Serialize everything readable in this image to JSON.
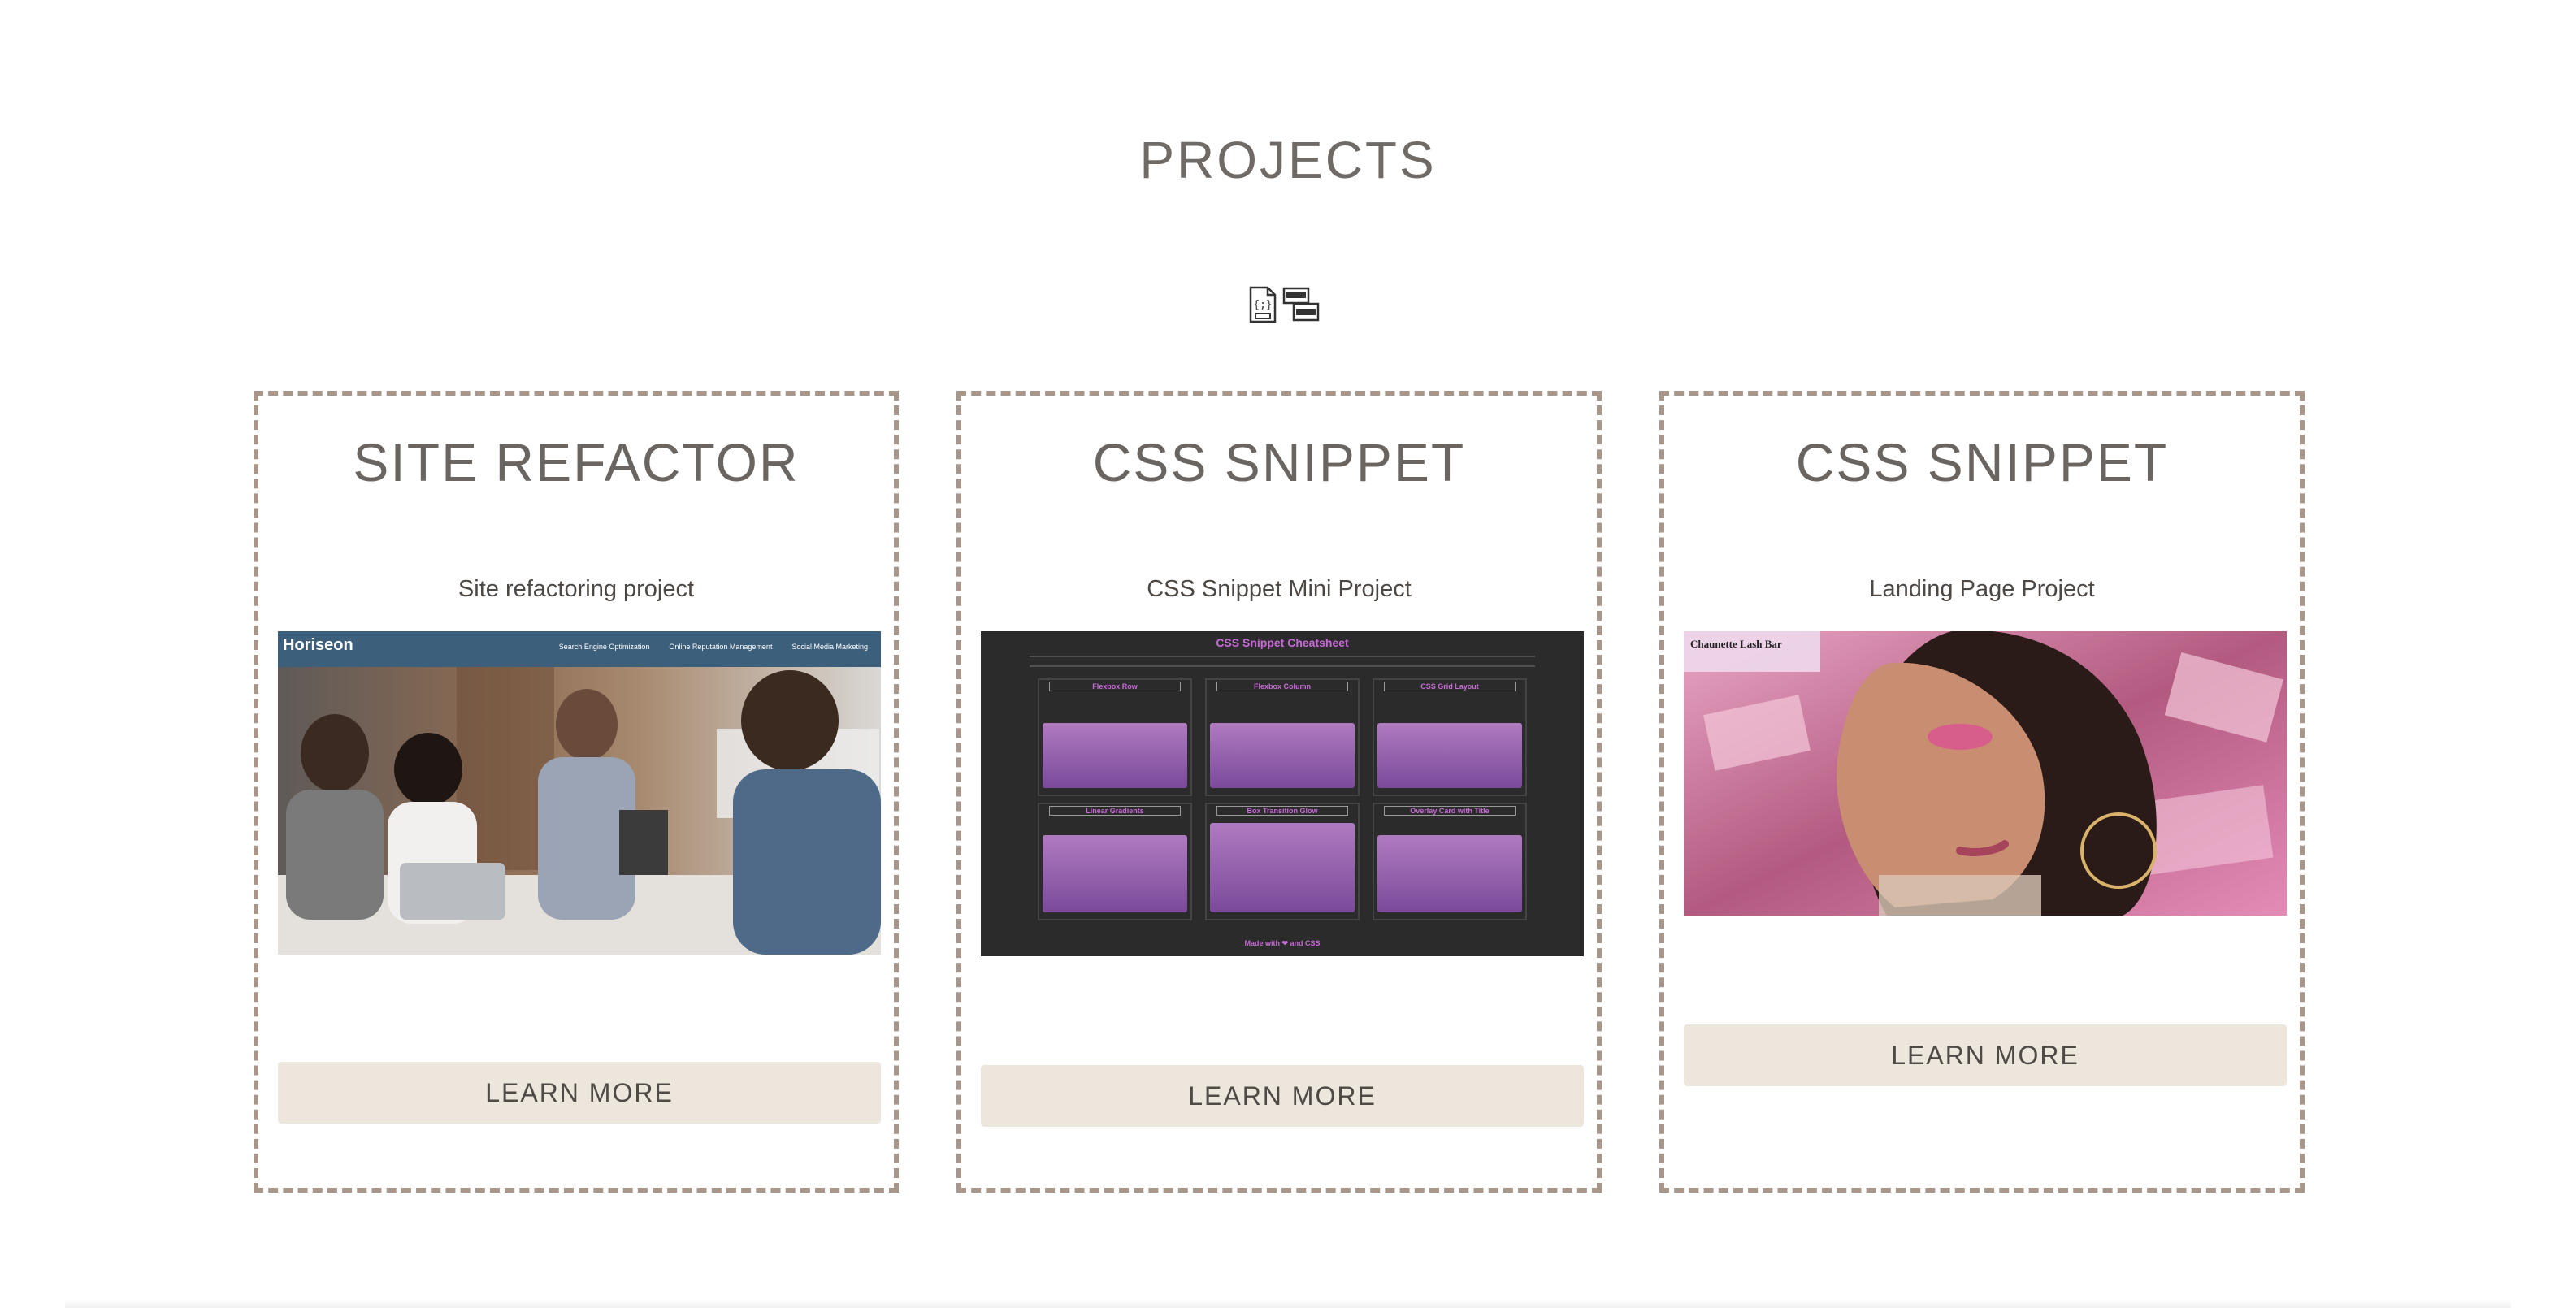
{
  "section": {
    "title": "PROJECTS"
  },
  "tech_icons": [
    "javascript-file-icon",
    "html-css-icon"
  ],
  "projects": [
    {
      "title": "SITE REFACTOR",
      "description": "Site refactoring project",
      "button_label": "LEARN MORE",
      "preview": {
        "logo": "Horiseon",
        "nav": [
          "Search Engine Optimization",
          "Online Reputation Management",
          "Social Media Marketing"
        ]
      }
    },
    {
      "title": "CSS SNIPPET",
      "description": "CSS Snippet Mini Project",
      "button_label": "LEARN MORE",
      "preview": {
        "heading": "CSS Snippet Cheatsheet",
        "cards": [
          "Flexbox Row",
          "Flexbox Column",
          "CSS Grid Layout",
          "Linear Gradients",
          "Box Transition Glow",
          "Overlay Card with Title"
        ],
        "footer": "Made with ❤ and CSS"
      }
    },
    {
      "title": "CSS SNIPPET",
      "description": "Landing Page Project",
      "button_label": "LEARN MORE",
      "preview": {
        "brand": "Chaunette Lash Bar"
      }
    }
  ],
  "colors": {
    "card_border": "#a8968a",
    "button_bg": "#ede6dc",
    "preview2_bg": "#2b2b2b",
    "preview2_accent": "#c86ad8",
    "preview1_header": "#3c5f7c",
    "preview3_pink": "#d97aa8"
  }
}
